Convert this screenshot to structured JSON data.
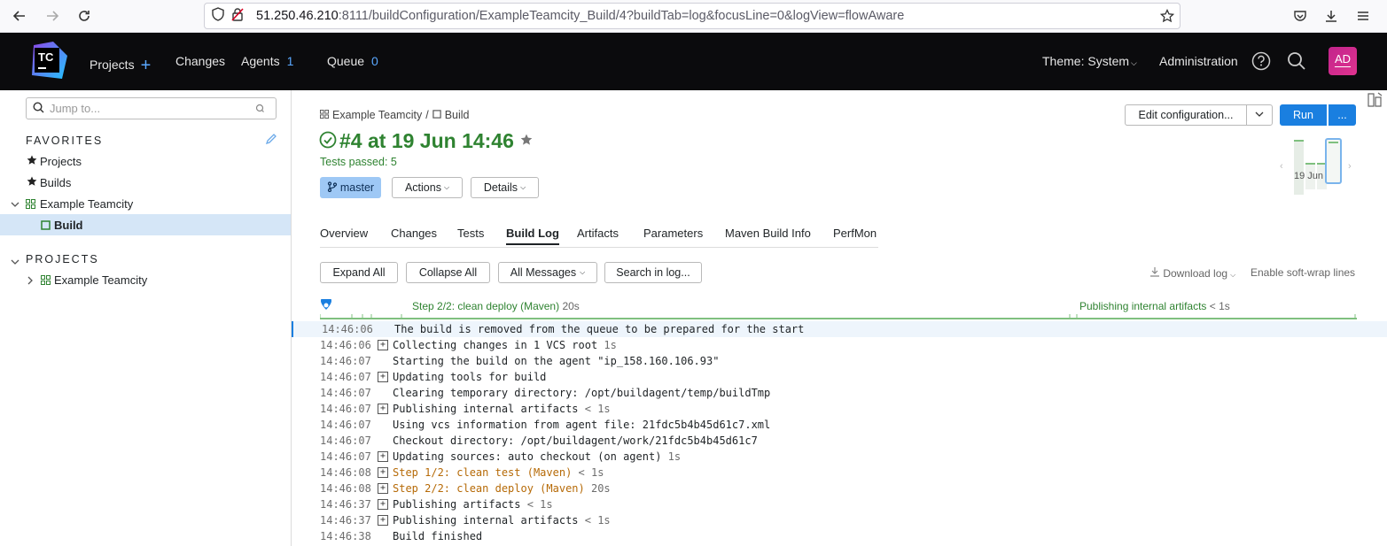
{
  "browser": {
    "url_host": "51.250.46.210",
    "url_rest": ":8111/buildConfiguration/ExampleTeamcity_Build/4?buildTab=log&focusLine=0&logView=flowAware"
  },
  "header": {
    "logo_text": "TC",
    "projects": "Projects",
    "changes": "Changes",
    "agents": "Agents",
    "agents_count": "1",
    "queue": "Queue",
    "queue_count": "0",
    "theme": "Theme: System",
    "administration": "Administration",
    "avatar": "AD"
  },
  "sidebar": {
    "jump_placeholder": "Jump to...",
    "favorites_title": "FAVORITES",
    "favorites": [
      {
        "label": "Projects"
      },
      {
        "label": "Builds"
      },
      {
        "label": "Example Teamcity"
      },
      {
        "label": "Build"
      }
    ],
    "projects_title": "PROJECTS",
    "projects": [
      {
        "label": "Example Teamcity"
      }
    ]
  },
  "build": {
    "crumb_project": "Example Teamcity",
    "crumb_sep": "/",
    "crumb_build": "Build",
    "title": "#4 at 19 Jun 14:46",
    "tests_passed": "Tests passed: 5",
    "branch": "master",
    "actions": "Actions",
    "details": "Details",
    "edit_config": "Edit configuration...",
    "run": "Run",
    "more": "...",
    "history_date": "19 Jun"
  },
  "tabs": [
    "Overview",
    "Changes",
    "Tests",
    "Build Log",
    "Artifacts",
    "Parameters",
    "Maven Build Info",
    "PerfMon"
  ],
  "log_toolbar": {
    "expand_all": "Expand All",
    "collapse_all": "Collapse All",
    "all_messages": "All Messages",
    "search": "Search in log...",
    "download": "Download log",
    "soft_wrap": "Enable soft-wrap lines"
  },
  "timeline": {
    "step2_label": "Step 2/2: clean deploy (Maven)",
    "step2_dur": "20s",
    "publish_label": "Publishing internal artifacts",
    "publish_dur": "< 1s"
  },
  "log": [
    {
      "time": "14:46:06",
      "msg": "The build is removed from the queue to be prepared for the start",
      "dur": "",
      "expandable": false,
      "orange": false
    },
    {
      "time": "14:46:06",
      "msg": "Collecting changes in 1 VCS root",
      "dur": "1s",
      "expandable": true,
      "orange": false
    },
    {
      "time": "14:46:07",
      "msg": "Starting the build on the agent \"ip_158.160.106.93\"",
      "dur": "",
      "expandable": false,
      "orange": false
    },
    {
      "time": "14:46:07",
      "msg": "Updating tools for build",
      "dur": "",
      "expandable": true,
      "orange": false
    },
    {
      "time": "14:46:07",
      "msg": "Clearing temporary directory: /opt/buildagent/temp/buildTmp",
      "dur": "",
      "expandable": false,
      "orange": false
    },
    {
      "time": "14:46:07",
      "msg": "Publishing internal artifacts",
      "dur": "< 1s",
      "expandable": true,
      "orange": false
    },
    {
      "time": "14:46:07",
      "msg": "Using vcs information from agent file: 21fdc5b4b45d61c7.xml",
      "dur": "",
      "expandable": false,
      "orange": false
    },
    {
      "time": "14:46:07",
      "msg": "Checkout directory: /opt/buildagent/work/21fdc5b4b45d61c7",
      "dur": "",
      "expandable": false,
      "orange": false
    },
    {
      "time": "14:46:07",
      "msg": "Updating sources: auto checkout (on agent)",
      "dur": "1s",
      "expandable": true,
      "orange": false
    },
    {
      "time": "14:46:08",
      "msg": "Step 1/2: clean test (Maven)",
      "dur": "< 1s",
      "expandable": true,
      "orange": true
    },
    {
      "time": "14:46:08",
      "msg": "Step 2/2: clean deploy (Maven)",
      "dur": "20s",
      "expandable": true,
      "orange": true
    },
    {
      "time": "14:46:37",
      "msg": "Publishing artifacts",
      "dur": "< 1s",
      "expandable": true,
      "orange": false
    },
    {
      "time": "14:46:37",
      "msg": "Publishing internal artifacts",
      "dur": "< 1s",
      "expandable": true,
      "orange": false
    },
    {
      "time": "14:46:38",
      "msg": "Build finished",
      "dur": "",
      "expandable": false,
      "orange": false
    }
  ]
}
